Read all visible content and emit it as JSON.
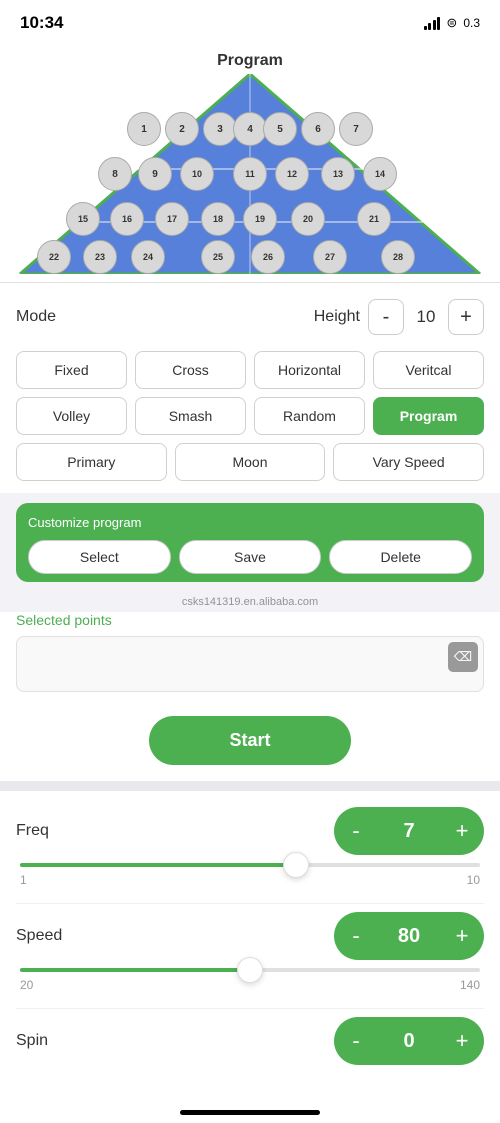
{
  "statusBar": {
    "time": "10:34",
    "battery": "0.3"
  },
  "header": {
    "title": "Program"
  },
  "court": {
    "balls": [
      {
        "num": "1",
        "row": 0,
        "col": 0
      },
      {
        "num": "2",
        "row": 0,
        "col": 1
      },
      {
        "num": "3",
        "row": 0,
        "col": 2
      },
      {
        "num": "4",
        "row": 0,
        "col": 3
      },
      {
        "num": "5",
        "row": 0,
        "col": 4
      },
      {
        "num": "6",
        "row": 0,
        "col": 5
      },
      {
        "num": "7",
        "row": 0,
        "col": 6
      },
      {
        "num": "8",
        "row": 1,
        "col": 0
      },
      {
        "num": "9",
        "row": 1,
        "col": 1
      },
      {
        "num": "10",
        "row": 1,
        "col": 2
      },
      {
        "num": "11",
        "row": 1,
        "col": 3
      },
      {
        "num": "12",
        "row": 1,
        "col": 4
      },
      {
        "num": "13",
        "row": 1,
        "col": 5
      },
      {
        "num": "14",
        "row": 1,
        "col": 6
      },
      {
        "num": "15",
        "row": 2,
        "col": 0
      },
      {
        "num": "16",
        "row": 2,
        "col": 1
      },
      {
        "num": "17",
        "row": 2,
        "col": 2
      },
      {
        "num": "18",
        "row": 2,
        "col": 3
      },
      {
        "num": "19",
        "row": 2,
        "col": 4
      },
      {
        "num": "20",
        "row": 2,
        "col": 5
      },
      {
        "num": "21",
        "row": 2,
        "col": 6
      },
      {
        "num": "22",
        "row": 3,
        "col": 0
      },
      {
        "num": "23",
        "row": 3,
        "col": 1
      },
      {
        "num": "24",
        "row": 3,
        "col": 2
      },
      {
        "num": "25",
        "row": 3,
        "col": 3
      },
      {
        "num": "26",
        "row": 3,
        "col": 4
      },
      {
        "num": "27",
        "row": 3,
        "col": 5
      },
      {
        "num": "28",
        "row": 3,
        "col": 6
      }
    ]
  },
  "controls": {
    "mode_label": "Mode",
    "height_label": "Height",
    "height_value": "10",
    "height_minus": "-",
    "height_plus": "+",
    "mode_buttons": [
      {
        "label": "Fixed",
        "active": false
      },
      {
        "label": "Cross",
        "active": false
      },
      {
        "label": "Horizontal",
        "active": false
      },
      {
        "label": "Veritcal",
        "active": false
      },
      {
        "label": "Volley",
        "active": false
      },
      {
        "label": "Smash",
        "active": false
      },
      {
        "label": "Random",
        "active": false
      },
      {
        "label": "Program",
        "active": true
      },
      {
        "label": "Primary",
        "active": false
      },
      {
        "label": "Moon",
        "active": false
      },
      {
        "label": "Vary Speed",
        "active": false
      }
    ]
  },
  "customize": {
    "label": "Customize program",
    "select_label": "Select",
    "save_label": "Save",
    "delete_label": "Delete",
    "watermark": "csks141319.en.alibaba.com",
    "selected_points_label": "Selected points",
    "clear_icon": "◀✕"
  },
  "actions": {
    "start_label": "Start"
  },
  "params": {
    "freq": {
      "label": "Freq",
      "value": "7",
      "minus": "-",
      "plus": "+",
      "slider_min": "1",
      "slider_max": "10",
      "slider_percent": 60
    },
    "speed": {
      "label": "Speed",
      "value": "80",
      "minus": "-",
      "plus": "+",
      "slider_min": "20",
      "slider_max": "140",
      "slider_percent": 50
    },
    "spin": {
      "label": "Spin",
      "value": "0",
      "minus": "-",
      "plus": "+"
    }
  }
}
